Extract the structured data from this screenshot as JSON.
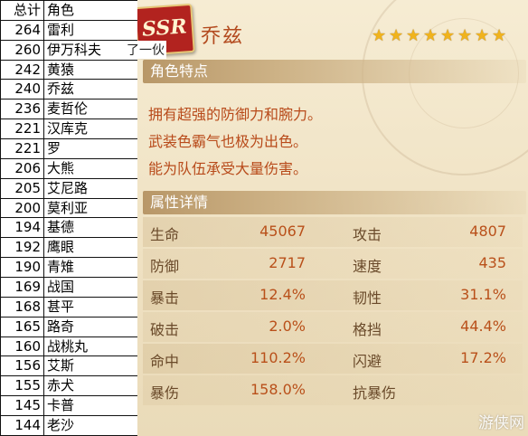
{
  "ranking": {
    "header": {
      "total": "总计",
      "role": "角色"
    },
    "rows": [
      {
        "total": "264",
        "name": "雷利"
      },
      {
        "total": "260",
        "name": "伊万科夫"
      },
      {
        "total": "242",
        "name": "黄猿"
      },
      {
        "total": "240",
        "name": "乔兹"
      },
      {
        "total": "236",
        "name": "麦哲伦"
      },
      {
        "total": "221",
        "name": "汉库克"
      },
      {
        "total": "221",
        "name": "罗"
      },
      {
        "total": "206",
        "name": "大熊"
      },
      {
        "total": "205",
        "name": "艾尼路"
      },
      {
        "total": "200",
        "name": "莫利亚"
      },
      {
        "total": "194",
        "name": "基德"
      },
      {
        "total": "192",
        "name": "鹰眼"
      },
      {
        "total": "190",
        "name": "青雉"
      },
      {
        "total": "169",
        "name": "战国"
      },
      {
        "total": "168",
        "name": "甚平"
      },
      {
        "total": "165",
        "name": "路奇"
      },
      {
        "total": "160",
        "name": "战桃丸"
      },
      {
        "total": "156",
        "name": "艾斯"
      },
      {
        "total": "155",
        "name": "赤犬"
      },
      {
        "total": "145",
        "name": "卡普"
      },
      {
        "total": "144",
        "name": "老沙"
      }
    ]
  },
  "character": {
    "rarity": "SSR",
    "name": "乔兹",
    "stars": 8,
    "overlap_text": "了一伙",
    "colors": {
      "badge": "#b2231f",
      "star": "#f0b31d",
      "accent": "#b84a1a"
    }
  },
  "traits": {
    "title": "角色特点",
    "lines": [
      "拥有超强的防御力和腕力。",
      "武装色霸气也极为出色。",
      "能为队伍承受大量伤害。"
    ]
  },
  "attributes": {
    "title": "属性详情",
    "rows": [
      {
        "l1": "生命",
        "v1": "45067",
        "l2": "攻击",
        "v2": "4807"
      },
      {
        "l1": "防御",
        "v1": "2717",
        "l2": "速度",
        "v2": "435"
      },
      {
        "l1": "暴击",
        "v1": "12.4%",
        "l2": "韧性",
        "v2": "31.1%"
      },
      {
        "l1": "破击",
        "v1": "2.0%",
        "l2": "格挡",
        "v2": "44.4%"
      },
      {
        "l1": "命中",
        "v1": "110.2%",
        "l2": "闪避",
        "v2": "17.2%"
      },
      {
        "l1": "暴伤",
        "v1": "158.0%",
        "l2": "抗暴伤",
        "v2": ""
      }
    ]
  },
  "watermark": "游侠网"
}
